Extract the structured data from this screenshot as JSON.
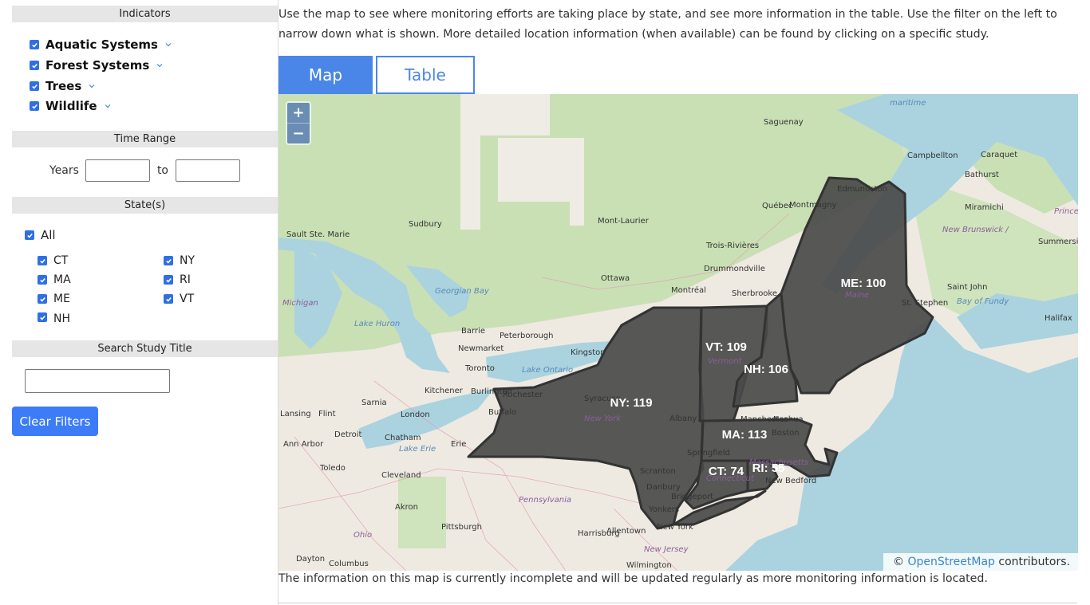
{
  "sidebar": {
    "indicators_heading": "Indicators",
    "indicators": [
      {
        "label": "Aquatic Systems",
        "checked": true
      },
      {
        "label": "Forest Systems",
        "checked": true
      },
      {
        "label": "Trees",
        "checked": true
      },
      {
        "label": "Wildlife",
        "checked": true
      }
    ],
    "time_range_heading": "Time Range",
    "years_label": "Years",
    "to_label": "to",
    "year_from": "",
    "year_to": "",
    "states_heading": "State(s)",
    "all_label": "All",
    "states": [
      {
        "label": "CT",
        "checked": true
      },
      {
        "label": "NY",
        "checked": true
      },
      {
        "label": "MA",
        "checked": true
      },
      {
        "label": "RI",
        "checked": true
      },
      {
        "label": "ME",
        "checked": true
      },
      {
        "label": "VT",
        "checked": true
      },
      {
        "label": "NH",
        "checked": true
      }
    ],
    "search_heading": "Search Study Title",
    "search_value": "",
    "clear_label": "Clear Filters"
  },
  "main": {
    "intro": "Use the map to see where monitoring efforts are taking place by state, and see more information in the table. Use the filter on the left to narrow down what is shown. More detailed location information (when available) can be found by clicking on a specific study.",
    "tabs": [
      {
        "label": "Map",
        "active": true
      },
      {
        "label": "Table",
        "active": false
      }
    ],
    "zoom_in": "+",
    "zoom_out": "−",
    "attribution_prefix": "©",
    "attribution_link": "OpenStreetMap",
    "attribution_suffix": "contributors.",
    "footnote": "The information on this map is currently incomplete and will be updated regularly as more monitoring information is located."
  },
  "map": {
    "state_counts": [
      {
        "state": "NY",
        "count": 119,
        "label": "NY: 119"
      },
      {
        "state": "VT",
        "count": 109,
        "label": "VT: 109"
      },
      {
        "state": "NH",
        "count": 106,
        "label": "NH: 106"
      },
      {
        "state": "ME",
        "count": 100,
        "label": "ME: 100"
      },
      {
        "state": "MA",
        "count": 113,
        "label": "MA: 113"
      },
      {
        "state": "CT",
        "count": 74,
        "label": "CT: 74"
      },
      {
        "state": "RI",
        "count": 55,
        "label": "RI: 55"
      }
    ],
    "cities": [
      "maritime",
      "Saguenay",
      "Campbellton",
      "Caraquet",
      "Bathurst",
      "Edmundston",
      "Québec",
      "Montmagny",
      "Miramichi",
      "Sudbury",
      "Mont-Laurier",
      "Trois-Rivières",
      "Sault Ste. Marie",
      "Summerside",
      "Drummondville",
      "Ottawa",
      "Montréal",
      "Sherbrooke",
      "Saint John",
      "St. Stephen",
      "Halifax",
      "Barrie",
      "Peterborough",
      "Kingston",
      "Newmarket",
      "Toronto",
      "Kitchener",
      "Burlington",
      "Rochester",
      "Syracuse",
      "Buffalo",
      "Sarnia",
      "London",
      "Lansing",
      "Flint",
      "Albany",
      "Manchester",
      "Nashua",
      "Boston",
      "Detroit",
      "Chatham",
      "Ann Arbor",
      "Erie",
      "Springfield",
      "Toledo",
      "Cleveland",
      "Scranton",
      "Danbury",
      "New Bedford",
      "Bridgeport",
      "Akron",
      "Yonkers",
      "Pittsburgh",
      "Harrisburg",
      "Allentown",
      "New York",
      "Dayton",
      "Columbus",
      "Wilmington"
    ],
    "water_labels": [
      "Georgian Bay",
      "Lake Huron",
      "Lake Ontario",
      "Lake Erie",
      "Bay of Fundy"
    ],
    "region_labels": [
      "Michigan",
      "New Brunswick / Nouveau-Brunswick",
      "Prince Edward Island",
      "Maine",
      "Vermont",
      "New York",
      "Massachusetts",
      "Connecticut",
      "Pennsylvania",
      "Ohio",
      "New Jersey"
    ],
    "colors": {
      "state_fill": "#4a4a4a",
      "land": "#eeeae2",
      "forest": "#c8dfb4",
      "water": "#aad3df"
    }
  }
}
